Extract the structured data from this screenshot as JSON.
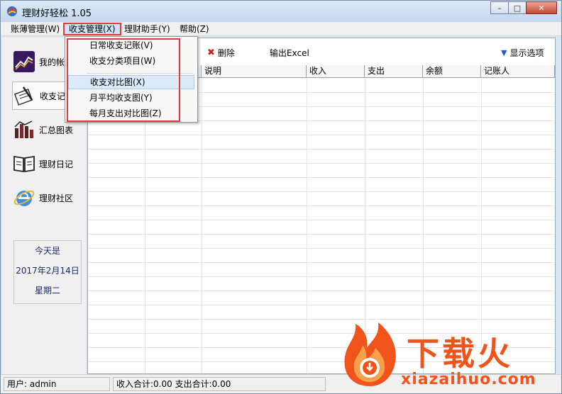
{
  "window": {
    "title": "理财好轻松 1.05"
  },
  "menubar": {
    "items": [
      {
        "label": "账薄管理(W)"
      },
      {
        "label": "收支管理(X)"
      },
      {
        "label": "理财助手(Y)"
      },
      {
        "label": "帮助(Z)"
      }
    ]
  },
  "dropdown": {
    "items": [
      {
        "label": "日常收支记账(V)"
      },
      {
        "label": "收支分类项目(W)"
      },
      {
        "label": "收支对比图(X)"
      },
      {
        "label": "月平均收支图(Y)"
      },
      {
        "label": "每月支出对比图(Z)"
      }
    ]
  },
  "sidebar": {
    "items": [
      {
        "label": "我的帐",
        "icon": "chart-line-icon"
      },
      {
        "label": "收支记",
        "icon": "notebook-pen-icon"
      },
      {
        "label": "汇总图表",
        "icon": "bar-chart-icon"
      },
      {
        "label": "理财日记",
        "icon": "book-icon"
      },
      {
        "label": "理财社区",
        "icon": "ie-browser-icon"
      }
    ],
    "date": {
      "line1": "今天是",
      "line2": "2017年2月14日",
      "line3": "星期二"
    }
  },
  "toolbar": {
    "delete_label": "删除",
    "export_label": "输出Excel",
    "options_label": "显示选项"
  },
  "grid": {
    "columns": [
      "说明",
      "收入",
      "支出",
      "余额",
      "记账人"
    ]
  },
  "status": {
    "user": "用户: admin",
    "totals": "收入合计:0.00 支出合计:0.00"
  },
  "watermark": {
    "text": "下载火",
    "domain": "xiazaihuo.com"
  },
  "colors": {
    "highlight_frame": "#e03a3a",
    "watermark": "#f0541b",
    "date_text": "#1a2b6e"
  }
}
